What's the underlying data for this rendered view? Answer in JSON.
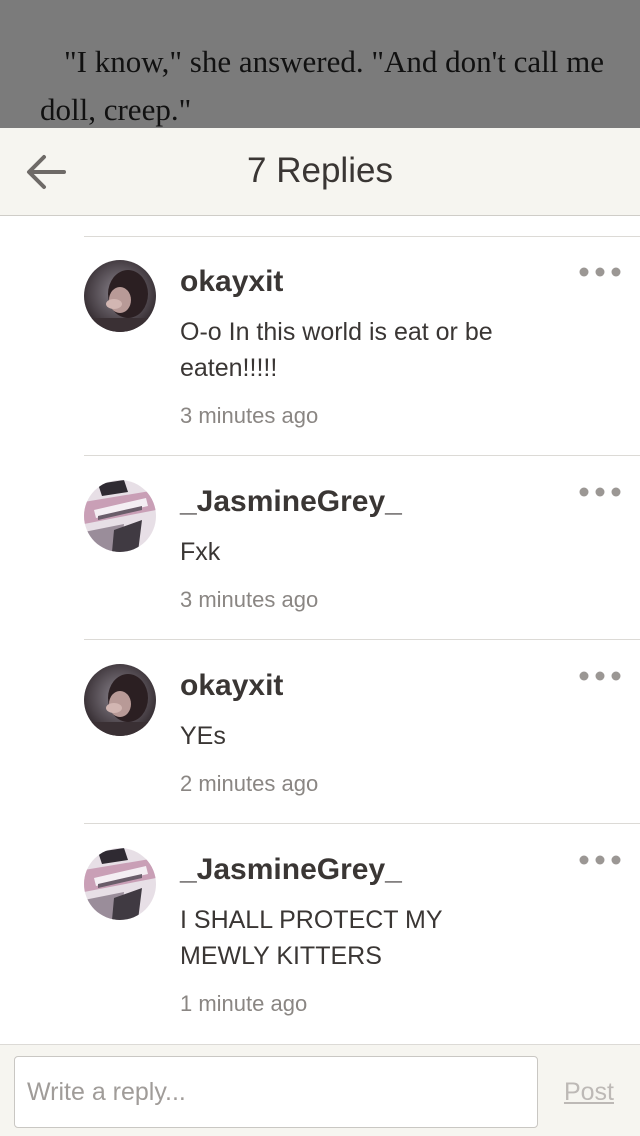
{
  "story": {
    "text": "\"I know,\" she answered. \"And don't call me doll, creep.\""
  },
  "header": {
    "title": "7 Replies"
  },
  "comments": [
    {
      "username": "okayxit",
      "text": "O-o In this world is eat or be eaten!!!!!",
      "time": "3 minutes ago"
    },
    {
      "username": "_JasmineGrey_",
      "text": "Fxk",
      "time": "3 minutes ago"
    },
    {
      "username": "okayxit",
      "text": "YEs",
      "time": "2 minutes ago"
    },
    {
      "username": "_JasmineGrey_",
      "text": "I SHALL PROTECT MY MEWLY KITTERS",
      "time": "1 minute ago"
    }
  ],
  "reply": {
    "placeholder": "Write a reply...",
    "post_label": "Post"
  },
  "colors": {
    "header_bg": "#f6f5f0",
    "text": "#3a3634",
    "muted": "#8a8683",
    "post_disabled": "#bdb9b6"
  }
}
